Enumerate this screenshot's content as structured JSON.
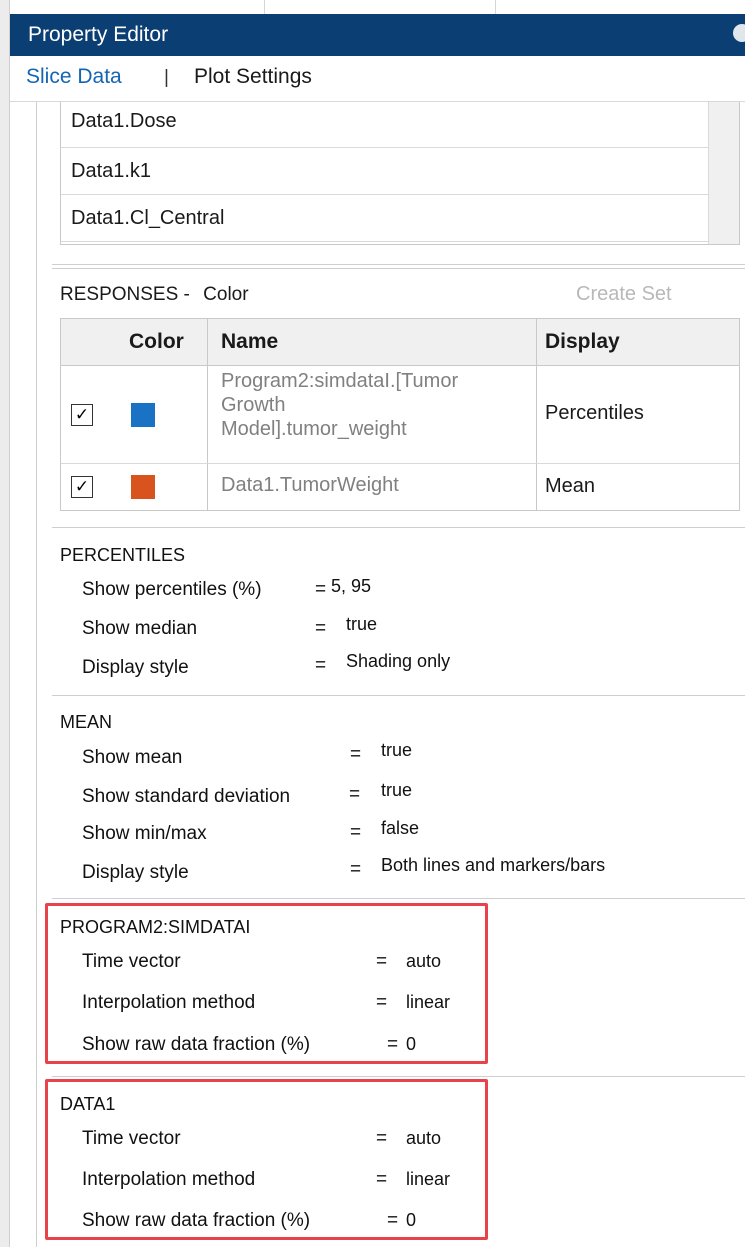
{
  "header": {
    "title": "Property Editor"
  },
  "tabs": [
    {
      "label": "Slice Data",
      "active": true
    },
    {
      "label": "Plot Settings",
      "active": false
    }
  ],
  "tab_separator": "|",
  "inputs": {
    "items": [
      "Data1.Dose",
      "Data1.k1",
      "Data1.Cl_Central"
    ]
  },
  "responses": {
    "title": "RESPONSES -",
    "grouping": "Color",
    "create_set_label": "Create Set",
    "columns": {
      "color": "Color",
      "name": "Name",
      "display": "Display"
    },
    "rows": [
      {
        "checked": true,
        "check_glyph": "✓",
        "color": "#1a72c4",
        "name_lines": [
          "Program2:simdataI.[Tumor",
          "Growth",
          "Model].tumor_weight"
        ],
        "display": "Percentiles"
      },
      {
        "checked": true,
        "check_glyph": "✓",
        "color": "#d9531e",
        "name_lines": [
          "Data1.TumorWeight"
        ],
        "display": "Mean"
      }
    ]
  },
  "percentiles": {
    "title": "PERCENTILES",
    "props": [
      {
        "label": "Show percentiles (%)",
        "eq": "=",
        "value": "5, 95"
      },
      {
        "label": "Show median",
        "eq": "=",
        "value": "true"
      },
      {
        "label": "Display style",
        "eq": "=",
        "value": "Shading only"
      }
    ]
  },
  "mean": {
    "title": "MEAN",
    "props": [
      {
        "label": "Show mean",
        "eq": "=",
        "value": "true"
      },
      {
        "label": "Show standard deviation",
        "eq": "=",
        "value": "true"
      },
      {
        "label": "Show min/max",
        "eq": "=",
        "value": "false"
      },
      {
        "label": "Display style",
        "eq": "=",
        "value": "Both lines and markers/bars"
      }
    ]
  },
  "program2": {
    "title": "PROGRAM2:SIMDATAI",
    "props": [
      {
        "label": "Time vector",
        "eq": "=",
        "value": "auto"
      },
      {
        "label": "Interpolation method",
        "eq": "=",
        "value": "linear"
      },
      {
        "label": "Show raw data fraction (%)",
        "eq": "=",
        "value": "0"
      }
    ]
  },
  "data1": {
    "title": "DATA1",
    "props": [
      {
        "label": "Time vector",
        "eq": "=",
        "value": "auto"
      },
      {
        "label": "Interpolation method",
        "eq": "=",
        "value": "linear"
      },
      {
        "label": "Show raw data fraction (%)",
        "eq": "=",
        "value": "0"
      }
    ]
  },
  "colors": {
    "title_bar": "#0b3f73",
    "active_tab": "#1565b5",
    "highlight_box": "#e8424a"
  }
}
